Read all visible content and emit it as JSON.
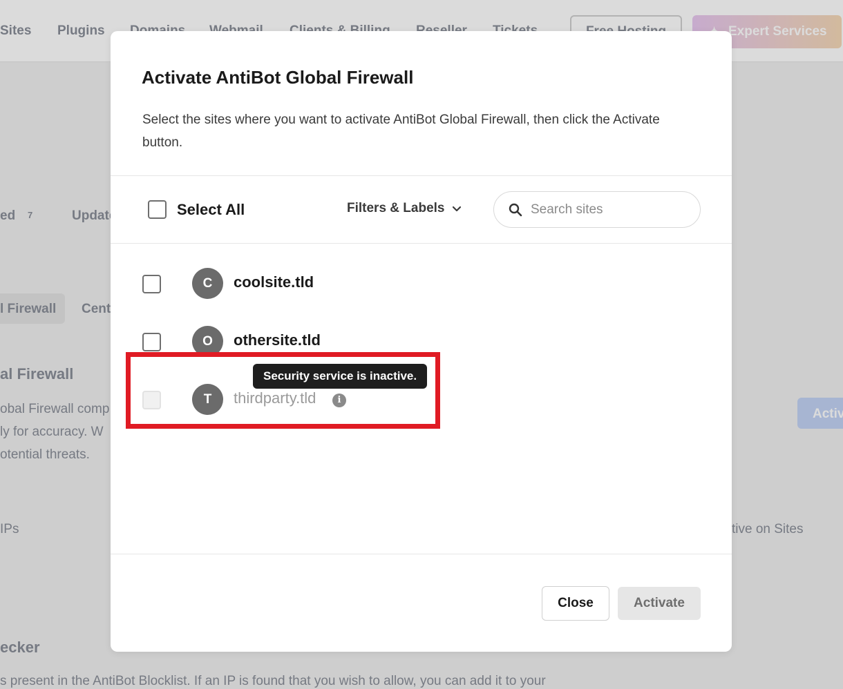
{
  "background": {
    "nav": [
      "Sites",
      "Plugins",
      "Domains",
      "Webmail",
      "Clients & Billing",
      "Reseller",
      "Tickets"
    ],
    "free_hosting_label": "Free Hosting",
    "expert_services_label": "Expert Services",
    "fragments": {
      "protected_label": "ed",
      "protected_count": "7",
      "updates_label": "Update",
      "tab_firewall": "l Firewall",
      "tab_center": "Cent",
      "section_title": "al Firewall",
      "desc_line1": "obal Firewall comp",
      "desc_line2": "ly for accuracy. W",
      "desc_line3": "otential threats.",
      "ips_label": "IPs",
      "active_on_sites": "tive on Sites",
      "checker_title": "ecker",
      "checker_desc": "s present in the AntiBot Blocklist. If an IP is found that you wish to allow, you can add it to your",
      "activate_btn": "Activ"
    }
  },
  "modal": {
    "title": "Activate AntiBot Global Firewall",
    "description": "Select the sites where you want to activate AntiBot Global Firewall, then click the Activate button.",
    "select_all_label": "Select All",
    "filters_label": "Filters & Labels",
    "search_placeholder": "Search sites",
    "sites": [
      {
        "initial": "C",
        "name": "coolsite.tld",
        "disabled": false
      },
      {
        "initial": "O",
        "name": "othersite.tld",
        "disabled": false
      },
      {
        "initial": "T",
        "name": "thirdparty.tld",
        "disabled": true
      }
    ],
    "tooltip": "Security service is inactive.",
    "close_label": "Close",
    "activate_label": "Activate"
  },
  "colors": {
    "highlight": "#e01b24",
    "avatar": "#6b6b6b",
    "tooltip_bg": "#1e1e1e"
  }
}
